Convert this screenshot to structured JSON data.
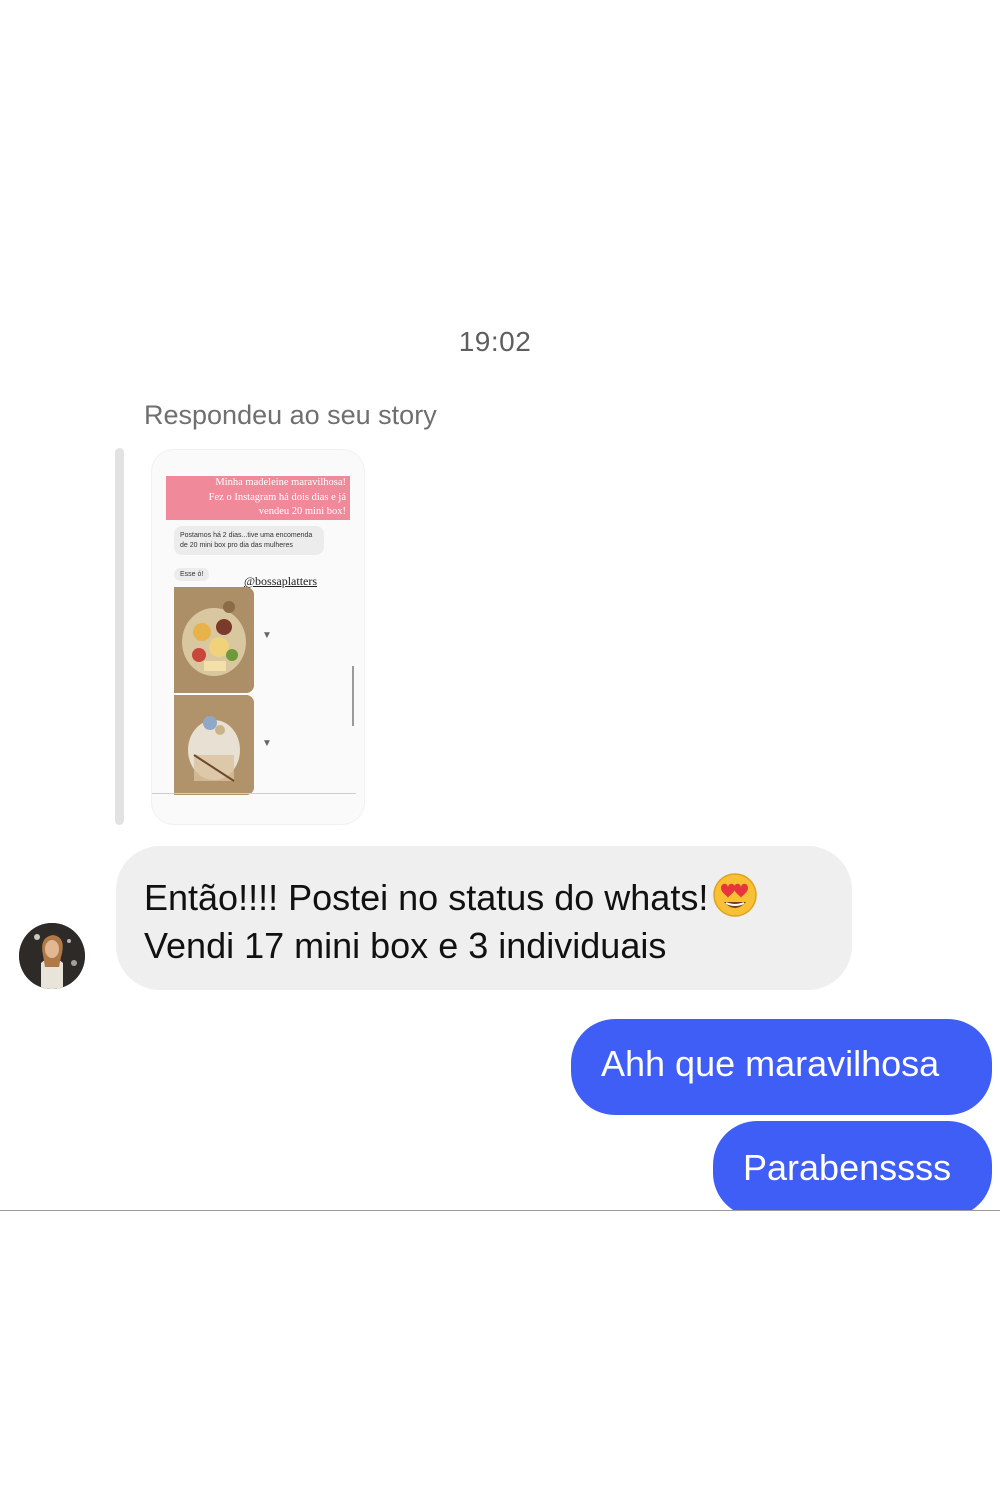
{
  "conversation": {
    "timestamp": "19:02",
    "reply_label": "Respondeu ao seu story",
    "story": {
      "header_lines": [
        "Minha madeleine maravilhosa!",
        "Fez o Instagram há dois dias e já",
        "vendeu 20 mini box!"
      ],
      "message": "Postamos há 2 dias...tive uma encomenda de 20 mini box pro dia das mulheres",
      "short_message": "Esse ó!",
      "tag": "@bossaplatters"
    },
    "incoming": {
      "line1": "Então!!!! Postei no status do whats!",
      "line2": "Vendi 17 mini box e 3 individuais",
      "emoji": "heart-eyes-emoji"
    },
    "outgoing": [
      {
        "text": "Ahh que maravilhosa"
      },
      {
        "text": "Parabenssss"
      }
    ]
  },
  "colors": {
    "outgoing_bubble": "#3f5ef5",
    "incoming_bubble": "#efefef",
    "story_header": "#f08a9a"
  }
}
